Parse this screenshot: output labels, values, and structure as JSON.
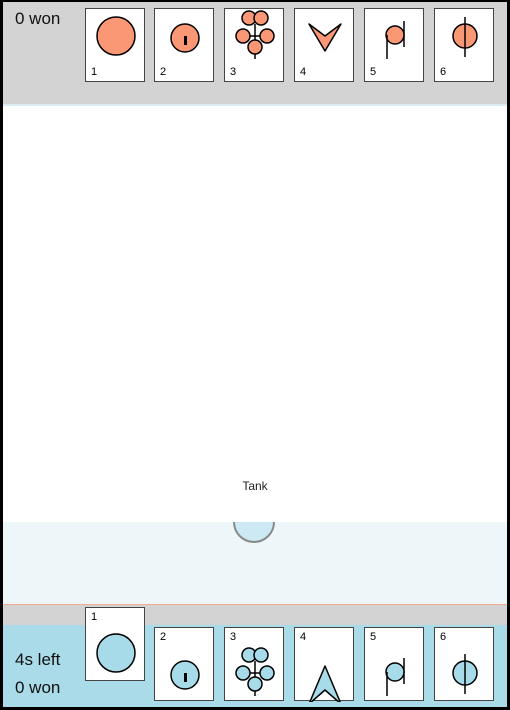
{
  "opponent": {
    "won_text": "0 won",
    "color": "#fa9876",
    "cards": [
      {
        "number": "1",
        "icon": "big-circle-icon"
      },
      {
        "number": "2",
        "icon": "circle-with-stem-icon"
      },
      {
        "number": "3",
        "icon": "cluster-of-circles-icon"
      },
      {
        "number": "4",
        "icon": "chevron-down-icon"
      },
      {
        "number": "5",
        "icon": "note-circle-icon"
      },
      {
        "number": "6",
        "icon": "circle-with-line-icon"
      }
    ]
  },
  "player": {
    "time_left": "4s left",
    "won_text": "0 won",
    "color": "#a7dbe9",
    "selected_card": "1",
    "cards": [
      {
        "number": "1",
        "icon": "big-circle-icon"
      },
      {
        "number": "2",
        "icon": "circle-with-stem-icon"
      },
      {
        "number": "3",
        "icon": "cluster-of-circles-icon"
      },
      {
        "number": "4",
        "icon": "chevron-up-icon"
      },
      {
        "number": "5",
        "icon": "note-circle-icon"
      },
      {
        "number": "6",
        "icon": "circle-with-line-icon"
      }
    ]
  },
  "arena": {
    "unit_label": "Tank",
    "unit_color": "#cde9f3"
  }
}
